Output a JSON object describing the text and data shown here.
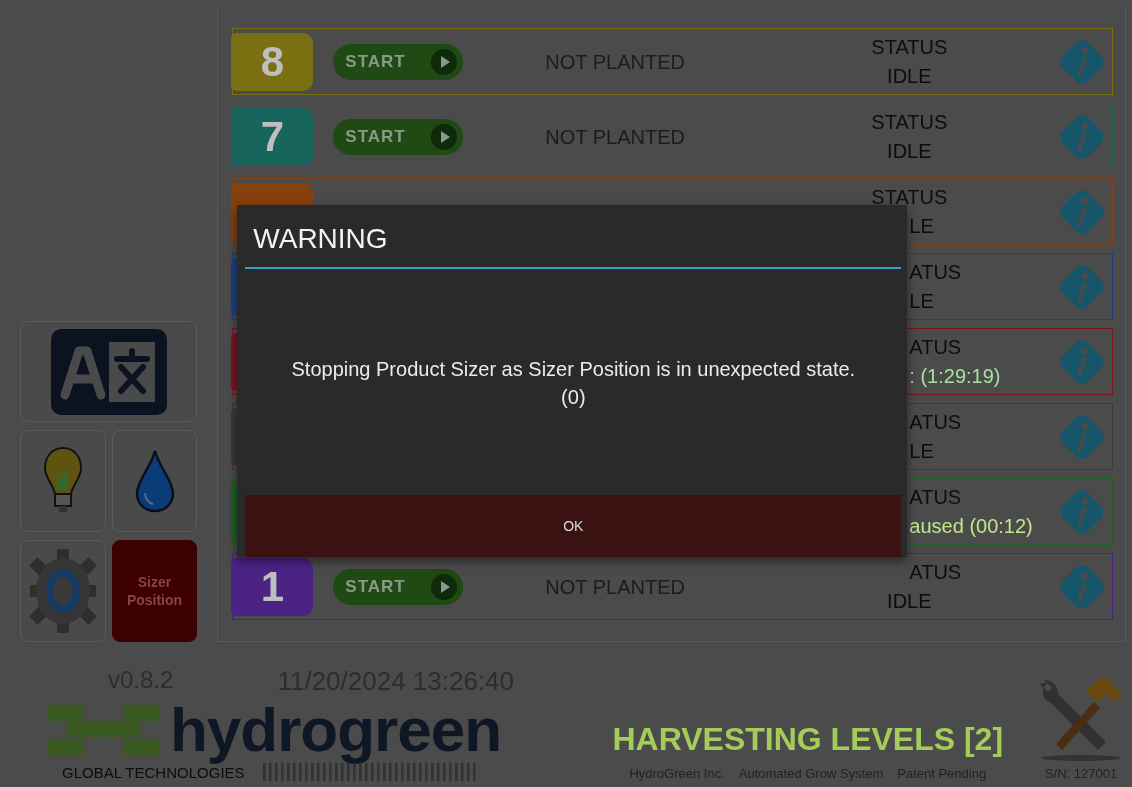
{
  "levels": [
    {
      "number": "8",
      "color": "#7a7012",
      "start": "START",
      "crop": "NOT PLANTED",
      "status_label": {
        "text": "STATUS",
        "clipped": false
      },
      "status_value": {
        "text": "IDLE",
        "clipped": false,
        "kind": "idle"
      }
    },
    {
      "number": "7",
      "color": "#17655d",
      "start": "START",
      "crop": "NOT PLANTED",
      "status_label": {
        "text": "STATUS",
        "clipped": false
      },
      "status_value": {
        "text": "IDLE",
        "clipped": false,
        "kind": "idle"
      }
    },
    {
      "color": "#87400f",
      "status_label": {
        "text": "STATUS",
        "clipped": false
      },
      "status_value": {
        "text": "LE",
        "clipped": true,
        "kind": "idle"
      }
    },
    {
      "color": "#1d3f7e",
      "status_label": {
        "text": "ATUS",
        "clipped": true
      },
      "status_value": {
        "text": "LE",
        "clipped": true,
        "kind": "idle"
      }
    },
    {
      "color": "#7e1420",
      "status_label": {
        "text": "ATUS",
        "clipped": true
      },
      "status_value": {
        "text": ": (1:29:19)",
        "clipped": true,
        "kind": "running"
      }
    },
    {
      "color": "#3a3a3a",
      "status_label": {
        "text": "ATUS",
        "clipped": true
      },
      "status_value": {
        "text": "LE",
        "clipped": true,
        "kind": "idle"
      }
    },
    {
      "color": "#1d6222",
      "status_label": {
        "text": "ATUS",
        "clipped": true
      },
      "status_value": {
        "text": "aused (00:12)",
        "clipped": true,
        "kind": "paused"
      }
    },
    {
      "number": "1",
      "color": "#4a2385",
      "start": "START",
      "crop": "NOT PLANTED",
      "status_label": {
        "text": "ATUS",
        "clipped": true
      },
      "status_value": {
        "text": "IDLE",
        "clipped": false,
        "kind": "idle"
      }
    }
  ],
  "sidebar": {
    "sizer_button": "Sizer Position"
  },
  "footer": {
    "version": "v0.8.2",
    "datetime": "11/20/2024 13:26:40",
    "logo_word": "hydrogreen",
    "logo_tagline": "GLOBAL TECHNOLOGIES",
    "mode": "HARVESTING LEVELS [2]",
    "company": "HydroGreen Inc.",
    "product": "Automated Grow System",
    "patent": "Patent Pending",
    "serial": "S/N: 127001"
  },
  "dialog": {
    "title": "WARNING",
    "message": "Stopping Product Sizer as Sizer Position is in unexpected state. (0)",
    "button": "OK"
  }
}
